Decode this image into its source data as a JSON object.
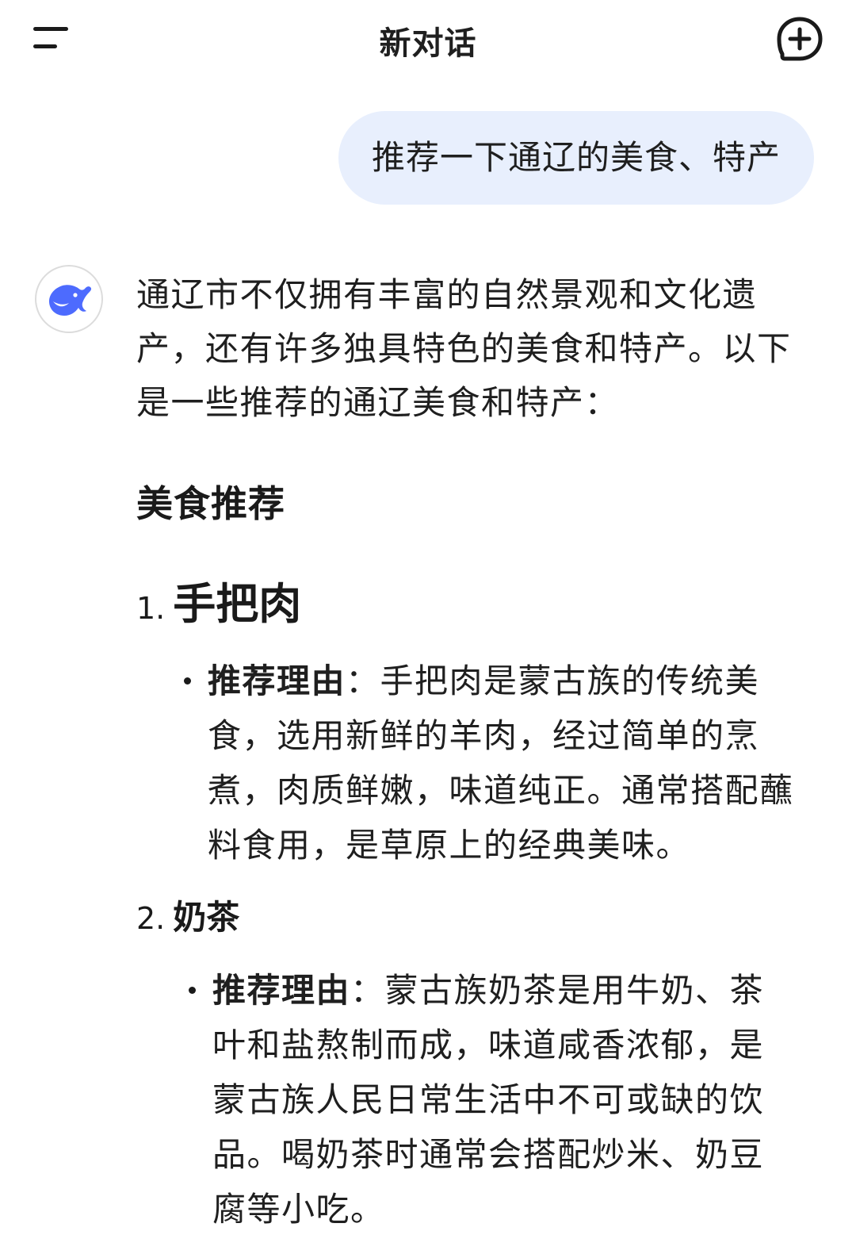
{
  "header": {
    "title": "新对话",
    "menu_icon": "menu-icon",
    "new_chat_icon": "new-chat-plus-icon"
  },
  "user_message": {
    "text": "推荐一下通辽的美食、特产"
  },
  "assistant": {
    "avatar_icon": "whale-logo-icon",
    "intro": "通辽市不仅拥有丰富的自然景观和文化遗产，还有许多独具特色的美食和特产。以下是一些推荐的通辽美食和特产：",
    "section_heading": "美食推荐",
    "items": [
      {
        "number": "1.",
        "name": "手把肉",
        "bullet_label": "推荐理由",
        "bullet_text": "：手把肉是蒙古族的传统美食，选用新鲜的羊肉，经过简单的烹煮，肉质鲜嫩，味道纯正。通常搭配蘸料食用，是草原上的经典美味。"
      },
      {
        "number": "2.",
        "name": "奶茶",
        "bullet_label": "推荐理由",
        "bullet_text": "：蒙古族奶茶是用牛奶、茶叶和盐熬制而成，味道咸香浓郁，是蒙古族人民日常生活中不可或缺的饮品。喝奶茶时通常会搭配炒米、奶豆腐等小吃。"
      }
    ]
  },
  "colors": {
    "user_bubble_bg": "#e8effd",
    "brand_blue": "#4d6bfe",
    "text": "#1f1f1f"
  }
}
